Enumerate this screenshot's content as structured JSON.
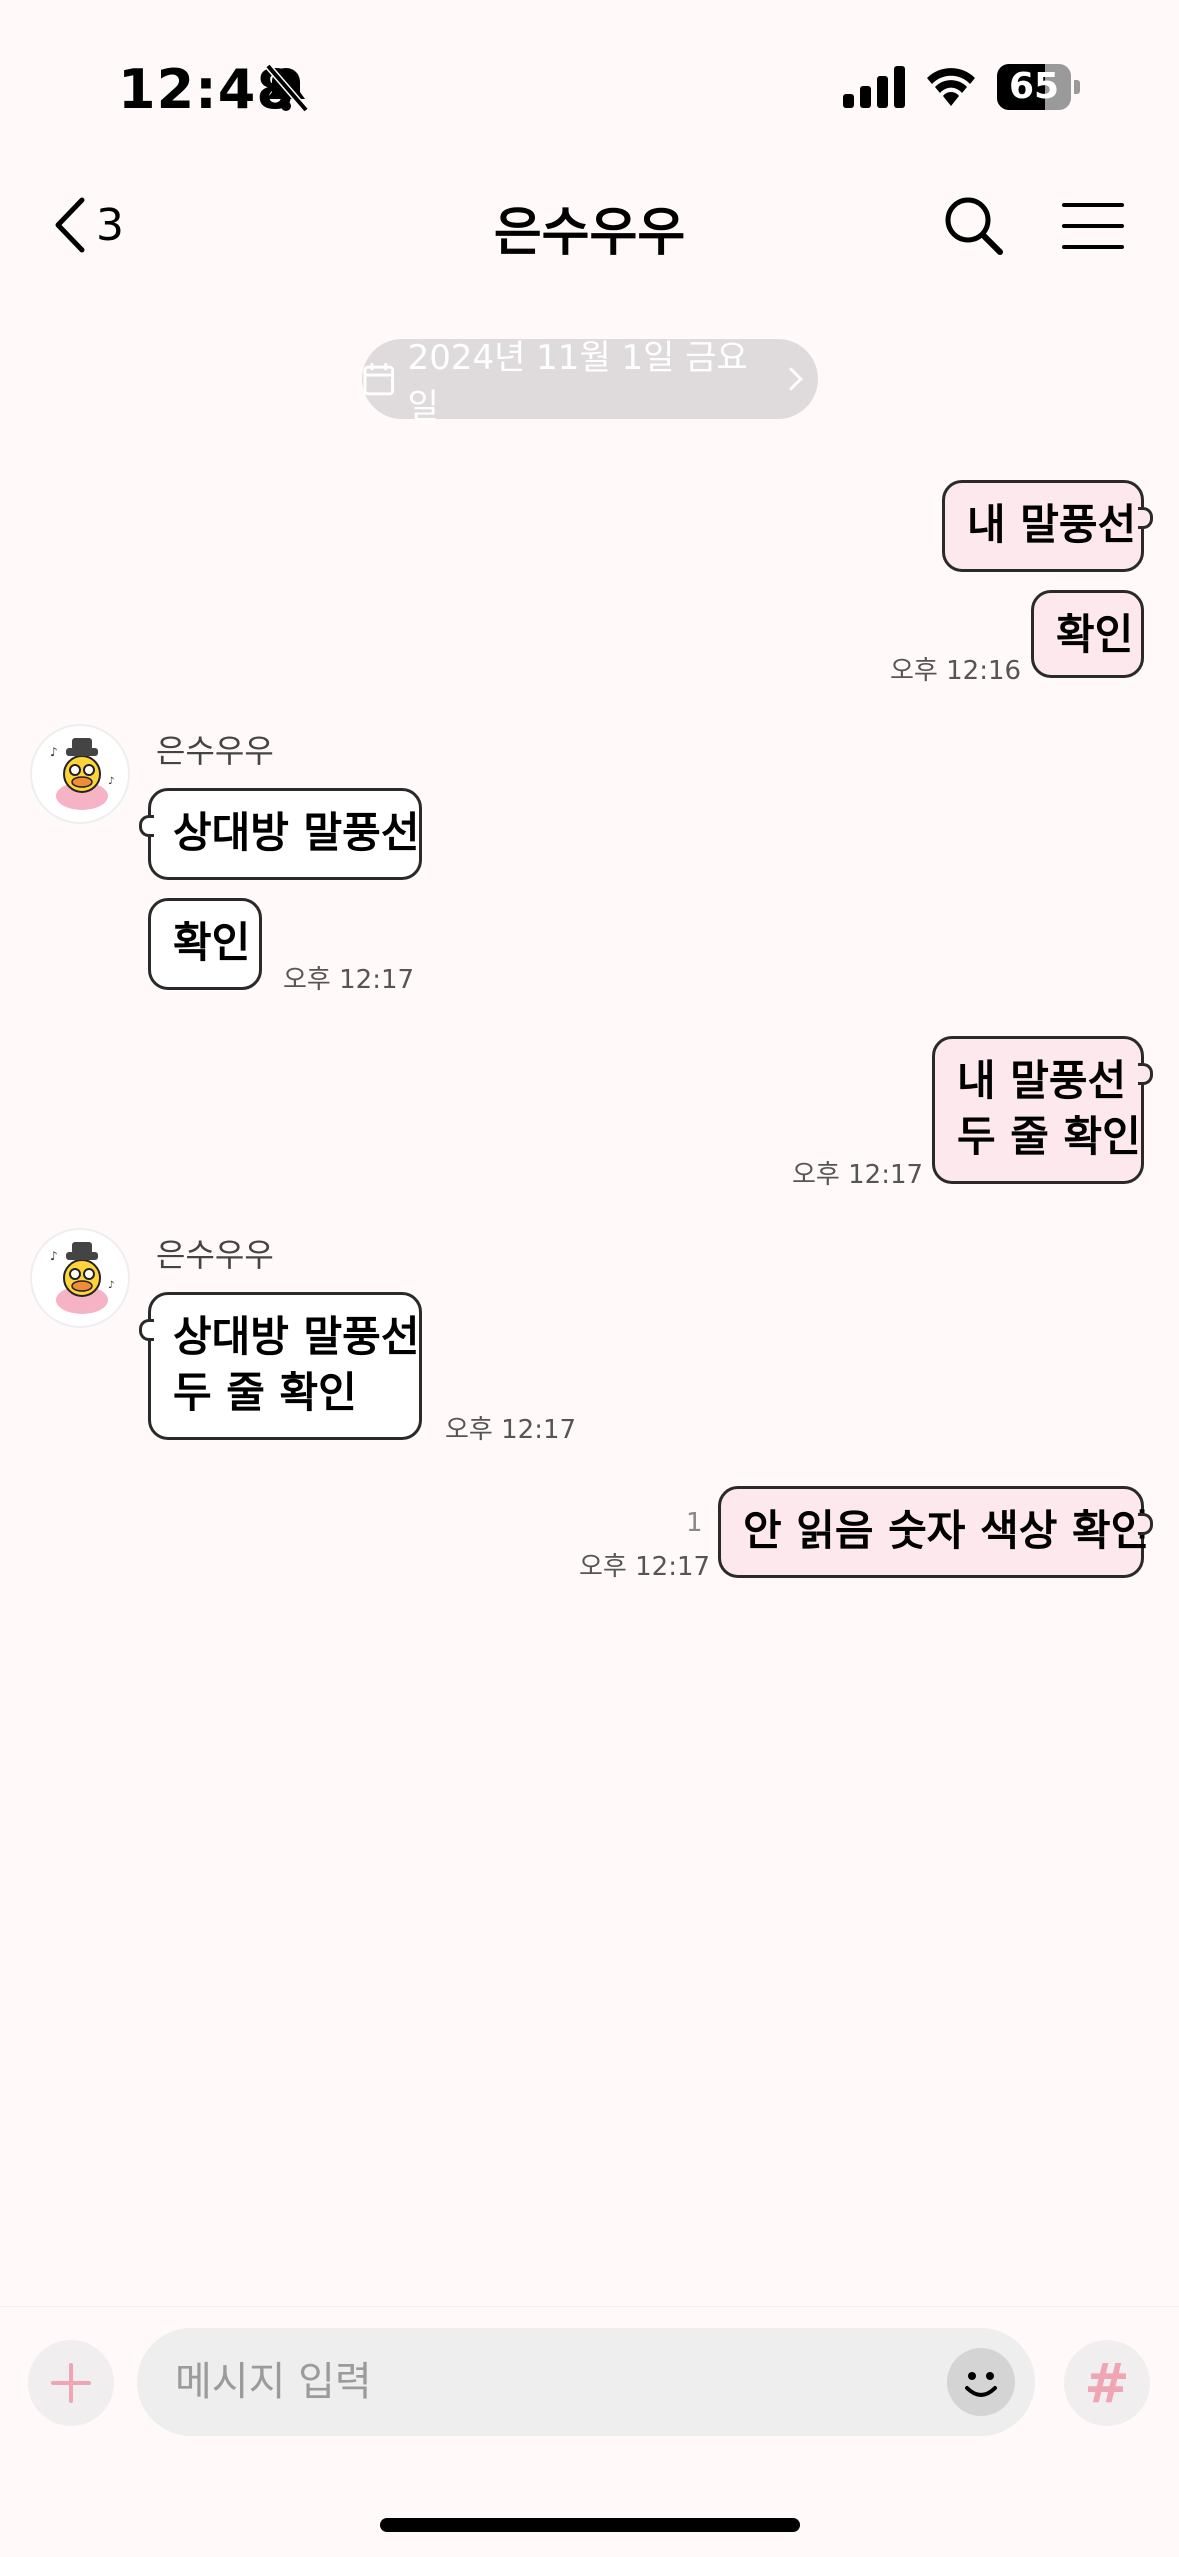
{
  "status_bar": {
    "time": "12:48",
    "battery": "65",
    "battery_level": 0.65,
    "icons": [
      "bell-slash-icon",
      "signal-icon",
      "wifi-icon",
      "battery-icon"
    ]
  },
  "header": {
    "back_count": "3",
    "title": "은수우우",
    "icons": [
      "chevron-left-icon",
      "search-icon",
      "menu-icon"
    ]
  },
  "date_divider": "2024년 11월 1일 금요일",
  "messages": {
    "m1": {
      "text": "내 말풍선"
    },
    "m2": {
      "text": "확인",
      "time": "오후 12:16"
    },
    "m3": {
      "sender": "은수우우",
      "text": "상대방 말풍선"
    },
    "m4": {
      "text": "확인",
      "time": "오후 12:17"
    },
    "m5": {
      "line1": "내 말풍선",
      "line2": "두 줄 확인",
      "time": "오후 12:17"
    },
    "m6": {
      "sender": "은수우우",
      "line1": "상대방 말풍선",
      "line2": "두 줄 확인",
      "time": "오후 12:17"
    },
    "m7": {
      "text": "안 읽음 숫자 색상 확인",
      "unread": "1",
      "time": "오후 12:17"
    }
  },
  "input_bar": {
    "placeholder": "메시지 입력",
    "hash_label": "#",
    "icons": [
      "plus-icon",
      "emoji-icon"
    ]
  },
  "colors": {
    "my_bubble": "#fde8ed",
    "their_bubble": "#ffffff",
    "background": "#fff9fa",
    "accent_pink": "#f0a5b4"
  }
}
